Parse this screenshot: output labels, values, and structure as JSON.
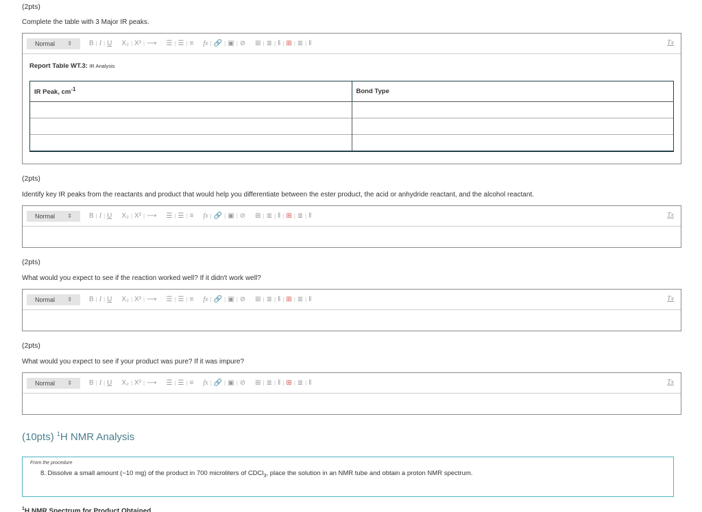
{
  "sections": [
    {
      "points": "(2pts)",
      "question": "Complete the table with 3 Major IR peaks.",
      "report_title_bold": "Report Table WT.3:",
      "report_title_sub": "IR Analysis",
      "table": {
        "headers": [
          "IR Peak, cm",
          "Bond Type"
        ],
        "header_superscript": "-1",
        "rows": [
          [
            "",
            ""
          ],
          [
            "",
            ""
          ],
          [
            "",
            ""
          ]
        ]
      }
    },
    {
      "points": "(2pts)",
      "question": "Identify key IR peaks from the reactants and product that would help you differentiate between the ester product, the acid or anhydride reactant, and the alcohol reactant.",
      "answer": ""
    },
    {
      "points": "(2pts)",
      "question": "What would you expect to see if the reaction worked well? If it didn't work well?",
      "answer": ""
    },
    {
      "points": "(2pts)",
      "question": "What would you expect to see if your product was pure? If it was impure?",
      "answer": ""
    }
  ],
  "toolbar": {
    "format_select": "Normal",
    "format_arrows": "⇕",
    "bold": "B",
    "italic": "I",
    "underline": "U",
    "subscript": "X₂",
    "superscript": "X²",
    "arrow": "⟶",
    "ordered_list": "☰",
    "unordered_list": "☰",
    "align": "≡",
    "formula": "fx",
    "link": "🔗",
    "image": "▣",
    "attachment": "⊘",
    "table": "⊞",
    "insert_row": "≣",
    "insert_col": "‖",
    "delete_table": "⊞",
    "delete_row": "≣",
    "delete_col": "‖",
    "clear_format": "Tx",
    "sep": "|"
  },
  "nmr": {
    "points": "(10pts) ",
    "sup": "1",
    "title": "H NMR Analysis",
    "procedure_label": "From the procedure",
    "step_prefix": "8. Dissolve a small amount (~10 mg) of the product in 700 microliters of CDCl",
    "step_sub": "3",
    "step_suffix": ", place the solution in an NMR tube and obtain a proton NMR spectrum.",
    "spectrum_sup": "1",
    "spectrum_title": "H NMR Spectrum for Product Obtained"
  }
}
